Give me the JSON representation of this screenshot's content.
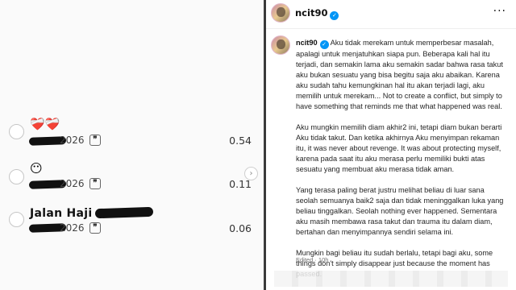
{
  "left_panel": {
    "rows": [
      {
        "emoji": "❤️‍🩹❤️‍🩹",
        "title": "",
        "year": "2026",
        "value": "0.54"
      },
      {
        "emoji": "😶",
        "title": "",
        "year": "2026",
        "value": "0.11"
      },
      {
        "emoji": "",
        "title": "Jalan Haji",
        "year": "2026",
        "value": "0.06"
      }
    ],
    "comment_icon": "❞",
    "scroll_arrow": "›"
  },
  "post": {
    "header": {
      "username": "ncit90",
      "more": "···"
    },
    "caption": {
      "username": "ncit90",
      "paragraphs": [
        "Aku tidak merekam untuk memperbesar masalah, apalagi untuk menjatuhkan siapa pun. Beberapa kali hal itu terjadi, dan semakin lama aku semakin sadar bahwa rasa takut aku bukan sesuatu yang bisa begitu saja aku abaikan. Karena aku sudah tahu kemungkinan hal itu akan terjadi lagi, aku memilih untuk merekam... Not to create a conflict, but simply to have something that reminds me that what happened was real.",
        "Aku mungkin memilih diam akhir2 ini, tetapi diam bukan berarti Aku tidak takut. Dan ketika akhirnya Aku menyimpan rekaman itu, it was never about revenge. It was about protecting myself, karena pada saat itu aku merasa perlu memiliki bukti atas sesuatu yang membuat aku merasa tidak aman.",
        "Yang terasa paling berat justru melihat beliau di luar sana seolah semuanya baik2 saja dan tidak meninggalkan luka yang beliau tinggalkan. Seolah nothing ever happened. Sementara aku masih membawa rasa takut dan trauma itu dalam diam, bertahan dan menyimpannya sendiri selama ini.",
        "Mungkin bagi beliau itu sudah berlalu, tetapi bagi aku, some things don't simply disappear just because the moment has passed."
      ]
    },
    "meta": "Edited · 10h"
  }
}
